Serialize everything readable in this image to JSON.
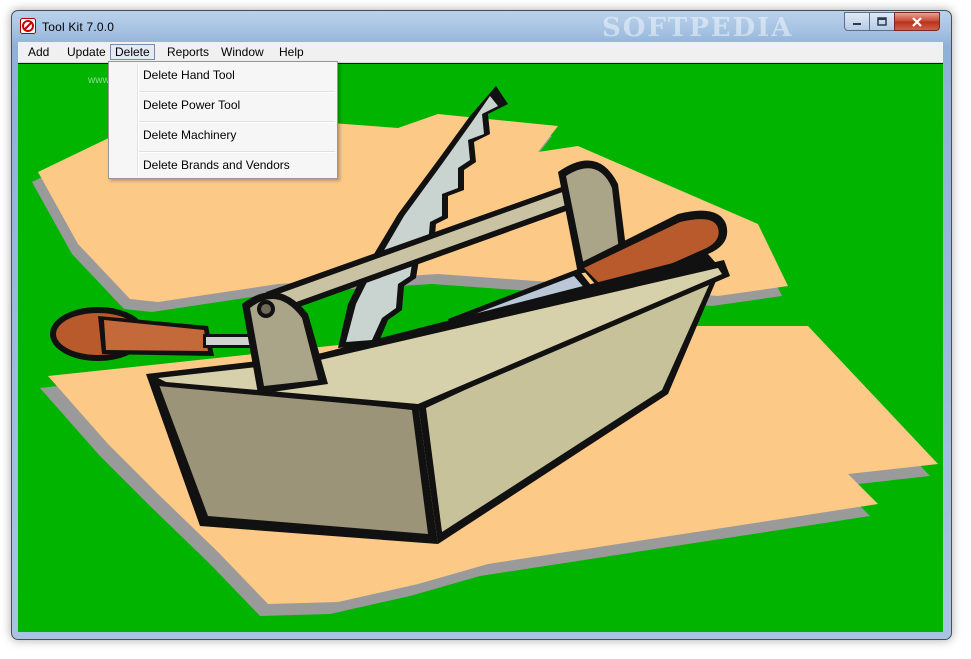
{
  "window": {
    "title": "Tool Kit  7.0.0",
    "watermark": "SOFTPEDIA",
    "watermark_url": "www.softpedia.com"
  },
  "menubar": {
    "items": [
      {
        "label": "Add"
      },
      {
        "label": "Update"
      },
      {
        "label": "Delete"
      },
      {
        "label": "Reports"
      },
      {
        "label": "Window"
      },
      {
        "label": "Help"
      }
    ]
  },
  "delete_menu": {
    "items": [
      {
        "label": "Delete Hand Tool"
      },
      {
        "label": "Delete Power Tool"
      },
      {
        "label": "Delete Machinery"
      },
      {
        "label": "Delete Brands and Vendors"
      }
    ]
  },
  "colors": {
    "background_green": "#00b400",
    "paper_tan": "#fdc987",
    "toolbox_olive": "#9b9478",
    "handle_brown": "#b85a2c"
  },
  "icons": {
    "app": "toolkit-app-icon",
    "minimize": "minimize-icon",
    "maximize": "maximize-icon",
    "close": "close-icon"
  }
}
